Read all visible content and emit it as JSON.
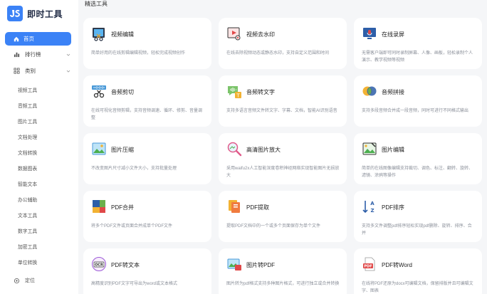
{
  "app": {
    "name": "即时工具"
  },
  "section_title": "精选工具",
  "sidebar": {
    "home": "首页",
    "ranking": "排行榜",
    "category": "类别",
    "sub_items": [
      "视频工具",
      "音频工具",
      "图片工具",
      "文档处理",
      "文档转换",
      "数据图表",
      "智能文本",
      "办公辅助",
      "文本工具",
      "数字工具",
      "加密工具",
      "单位转换"
    ],
    "locate": "定位"
  },
  "cards": [
    {
      "title": "视频编辑",
      "desc": "简单好用的在线剪辑编辑视频，轻松完成视频创作",
      "icon": "video-edit-icon"
    },
    {
      "title": "视频去水印",
      "desc": "在线去除视频动态或静态水印，支持自定义范围和时间",
      "icon": "video-watermark-icon"
    },
    {
      "title": "在线录屏",
      "desc": "无需客户端即可同时录制屏幕、人像、画板，轻松录制个人演示、教学视频等视频",
      "icon": "screen-record-icon"
    },
    {
      "title": "音频剪切",
      "desc": "在线可视化音频剪辑，支持音频调速、循环、修剪、音量调整",
      "icon": "audio-cut-icon"
    },
    {
      "title": "音频转文字",
      "desc": "支持多语言音频文件转文字、字幕、文档，智能AI识别语音",
      "icon": "audio-to-text-icon"
    },
    {
      "title": "音频拼接",
      "desc": "支持多段音频合并成一段音频，同时可进行不同格式输出",
      "icon": "audio-merge-icon"
    },
    {
      "title": "图片压缩",
      "desc": "不改变图片尺寸减小文件大小，支持批量处理",
      "icon": "image-compress-icon"
    },
    {
      "title": "高清图片放大",
      "desc": "采用waifu2x人工智能深度卷积神经网络实现智能图片无损放大",
      "icon": "image-upscale-icon"
    },
    {
      "title": "图片编辑",
      "desc": "简单的在线图像编辑支持裁切、调色、标注、翻转、旋转、滤镜、涂鸦等操作",
      "icon": "image-edit-icon"
    },
    {
      "title": "PDF合并",
      "desc": "将多个PDF文件或页面合并成单个PDF文件",
      "icon": "pdf-merge-icon"
    },
    {
      "title": "PDF提取",
      "desc": "提取PDF文档中的一个或多个页面保存为单个文件",
      "icon": "pdf-extract-icon"
    },
    {
      "title": "PDF排序",
      "desc": "支持多文件调整pdf排序轻松实现pdf删除、旋转、排序、合并",
      "icon": "pdf-sort-icon"
    },
    {
      "title": "PDF转文本",
      "desc": "高精度识别PDF文字可导出为word或文本格式",
      "icon": "pdf-to-text-icon"
    },
    {
      "title": "图片转PDF",
      "desc": "图片转为pdf格式支持多种图片格式，可进行独立或合并转换",
      "icon": "image-to-pdf-icon"
    },
    {
      "title": "PDF转Word",
      "desc": "在线将PDF还原为docx可编辑文档，保留排版并且可编辑文字、图表",
      "icon": "pdf-to-word-icon"
    }
  ],
  "colors": {
    "accent": "#3b82f6",
    "background": "#f5f6f8",
    "card": "#ffffff"
  }
}
